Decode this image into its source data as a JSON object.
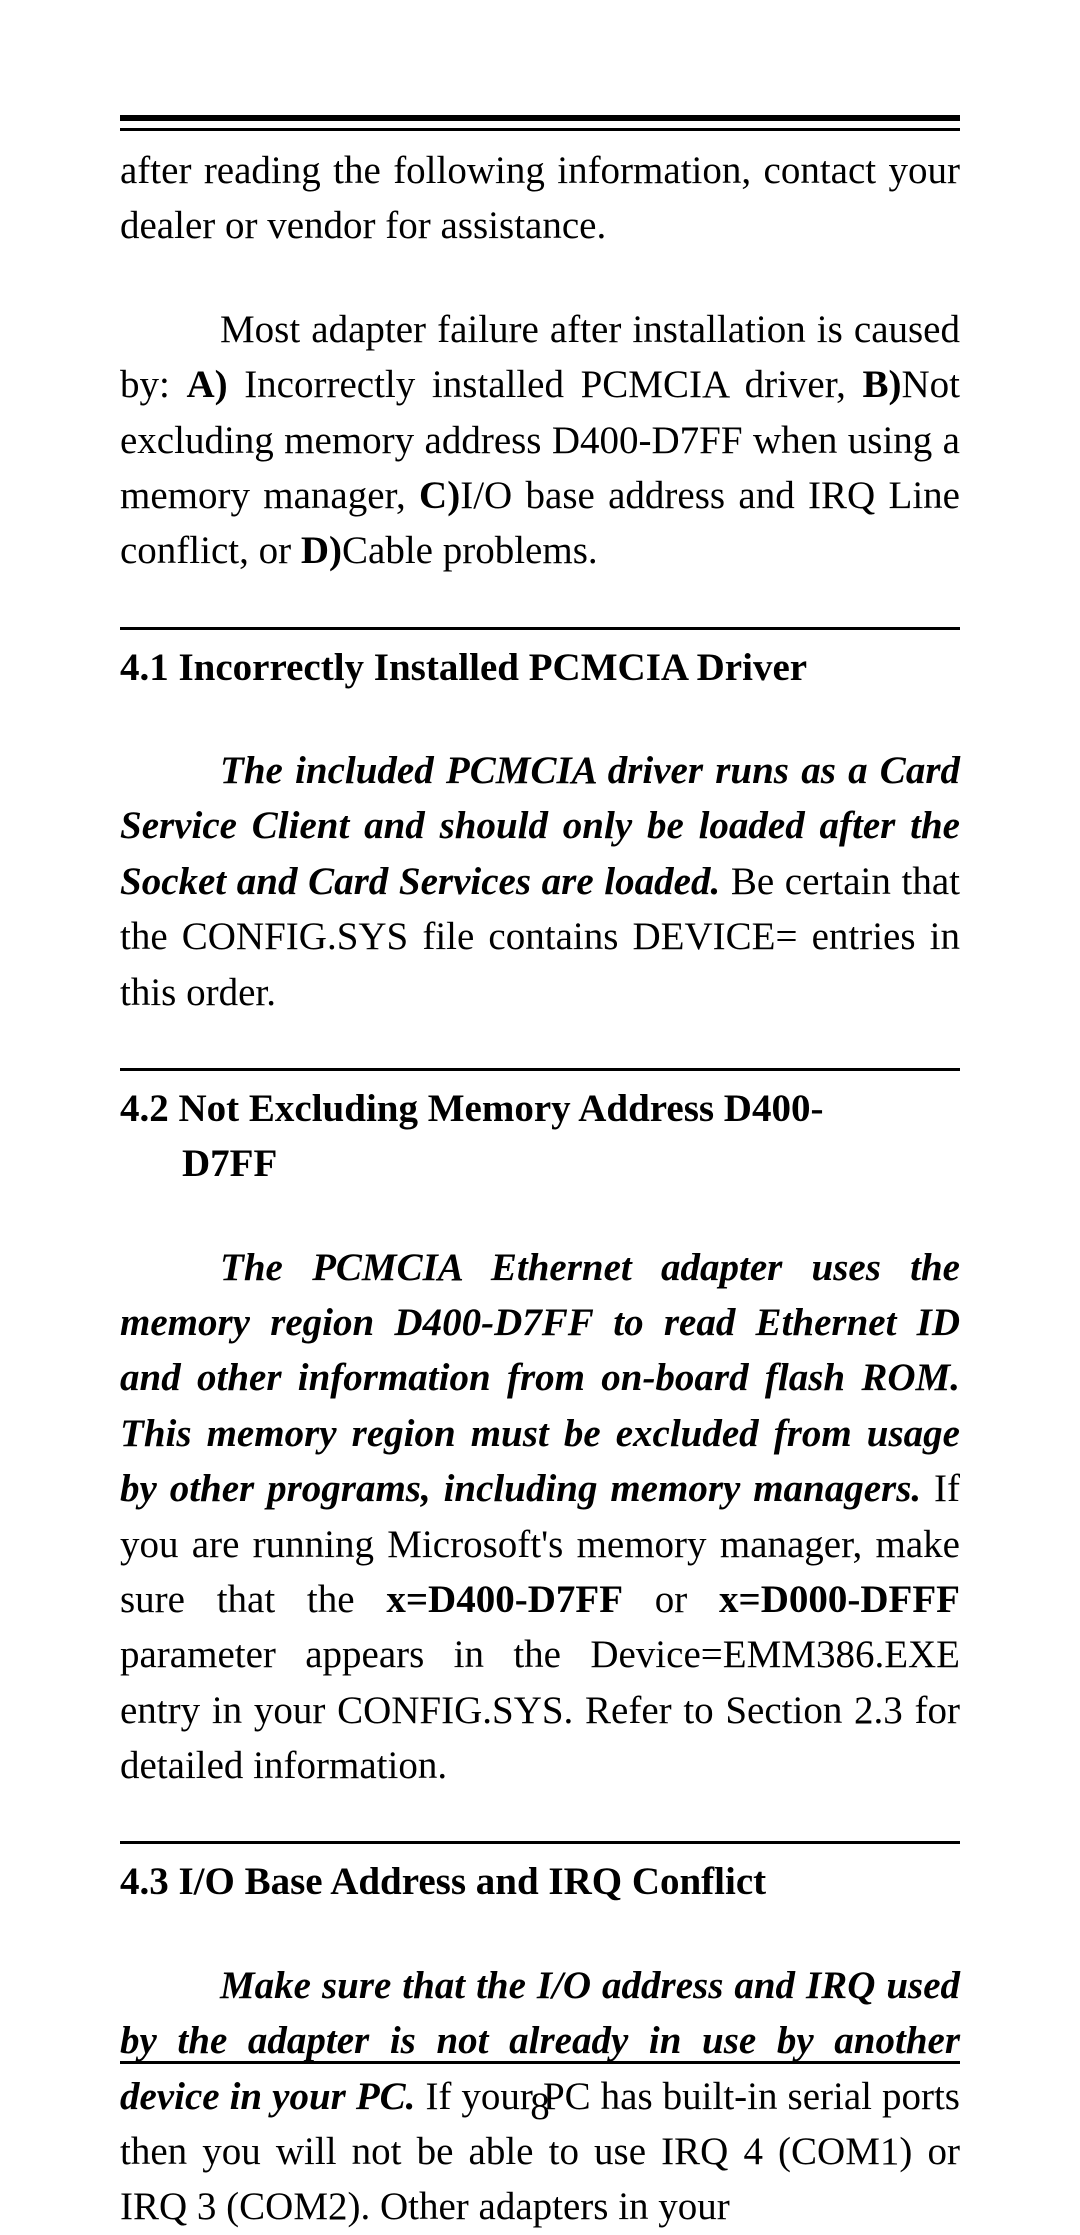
{
  "para1": "after reading the following information, contact your dealer or vendor for assistance.",
  "para2_pre": "Most adapter failure after installation is caused by: ",
  "para2_a": "A)",
  "para2_a_txt": " Incorrectly installed PCMCIA driver, ",
  "para2_b": "B)",
  "para2_b_txt": "Not excluding memory address D400-D7FF when using a memory manager, ",
  "para2_c": "C)",
  "para2_c_txt": "I/O base address and IRQ Line conflict, or ",
  "para2_d": "D)",
  "para2_d_txt": "Cable problems.",
  "h41": "4.1 Incorrectly Installed PCMCIA Driver",
  "p41_i": "The included PCMCIA driver runs as a Card Service Client and should only be loaded after the Socket and Card Services are loaded.",
  "p41_r": " Be certain that the CONFIG.SYS file contains DEVICE= entries in this order.",
  "h42_a": "4.2 Not Excluding Memory Address D400-",
  "h42_b": "D7FF",
  "p42_i": "The PCMCIA Ethernet adapter uses the memory region D400-D7FF to read Ethernet ID and other information from on-board flash ROM. This memory region must be excluded from usage by other programs, including memory managers.",
  "p42_r1": " If you are running Microsoft's memory manager, make sure that the ",
  "p42_b1": "x=D400-D7FF",
  "p42_r2": " or ",
  "p42_b2": "x=D000-DFFF",
  "p42_r3": " parameter appears in the Device=EMM386.EXE entry in your CONFIG.SYS.  Refer to Section 2.3 for detailed information.",
  "h43": "4.3 I/O Base Address and IRQ Conflict",
  "p43_i": "Make sure that the I/O address and IRQ used by the adapter is not already in use by another device in your PC.",
  "p43_r": " If your PC has built-in serial ports then you will not be able to use IRQ 4 (COM1) or IRQ 3 (COM2). Other adapters in your",
  "page_num": "8"
}
